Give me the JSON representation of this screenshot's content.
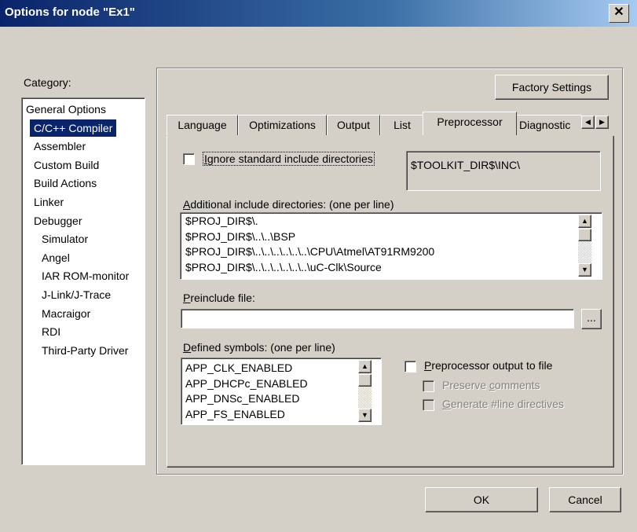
{
  "window": {
    "title": "Options for node \"Ex1\"",
    "close_label": "✕"
  },
  "category": {
    "label": "Category:",
    "items": [
      {
        "label": "General Options",
        "indent": 0
      },
      {
        "label": "C/C++ Compiler",
        "indent": 1,
        "selected": true
      },
      {
        "label": "Assembler",
        "indent": 1
      },
      {
        "label": "Custom Build",
        "indent": 1
      },
      {
        "label": "Build Actions",
        "indent": 1
      },
      {
        "label": "Linker",
        "indent": 1
      },
      {
        "label": "Debugger",
        "indent": 1
      },
      {
        "label": "Simulator",
        "indent": 2
      },
      {
        "label": "Angel",
        "indent": 2
      },
      {
        "label": "IAR ROM-monitor",
        "indent": 2
      },
      {
        "label": "J-Link/J-Trace",
        "indent": 2
      },
      {
        "label": "Macraigor",
        "indent": 2
      },
      {
        "label": "RDI",
        "indent": 2
      },
      {
        "label": "Third-Party Driver",
        "indent": 2
      }
    ]
  },
  "factory_settings_label": "Factory Settings",
  "tabs": [
    "Language",
    "Optimizations",
    "Output",
    "List",
    "Preprocessor",
    "Diagnostic"
  ],
  "active_tab": "Preprocessor",
  "tab_scroll": {
    "left": "◀",
    "right": "▶"
  },
  "ignore_std": {
    "label_u": "I",
    "label_rest": "gnore standard include directories",
    "checked": false
  },
  "std_include_path": "$TOOLKIT_DIR$\\INC\\",
  "additional_include": {
    "label_u": "A",
    "label_rest": "dditional include directories: (one per line)",
    "lines": [
      "$PROJ_DIR$\\.",
      "$PROJ_DIR$\\..\\..\\BSP",
      "$PROJ_DIR$\\..\\..\\..\\..\\..\\..\\CPU\\Atmel\\AT91RM9200",
      "$PROJ_DIR$\\..\\..\\..\\..\\..\\..\\uC-Clk\\Source"
    ]
  },
  "preinclude": {
    "label_u": "P",
    "label_rest": "reinclude file:",
    "value": "",
    "browse_label": "..."
  },
  "defined_symbols": {
    "label_u": "D",
    "label_rest": "efined symbols: (one per line)",
    "lines": [
      "APP_CLK_ENABLED",
      "APP_DHCPc_ENABLED",
      "APP_DNSc_ENABLED",
      "APP_FS_ENABLED"
    ]
  },
  "preproc_output": {
    "label_u": "P",
    "label_rest": "reprocessor output to file",
    "checked": false
  },
  "preserve_comments": {
    "label_pre": "Preserve ",
    "label_u": "c",
    "label_rest": "omments",
    "checked": false,
    "enabled": false
  },
  "generate_line": {
    "label_u": "G",
    "label_rest": "enerate #line directives",
    "checked": false,
    "enabled": false
  },
  "buttons": {
    "ok": "OK",
    "cancel": "Cancel"
  },
  "scroll_glyphs": {
    "up": "▲",
    "down": "▼"
  }
}
